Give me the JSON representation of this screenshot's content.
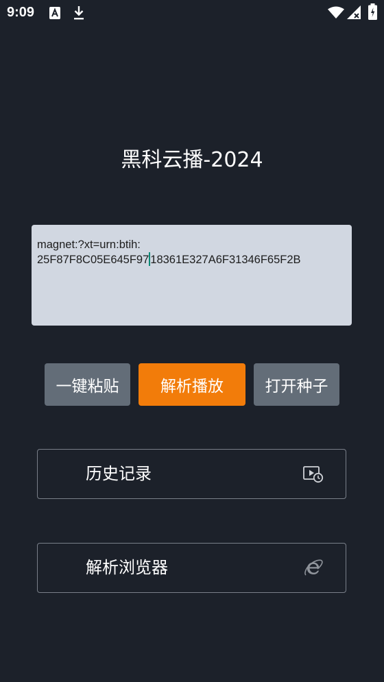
{
  "status_bar": {
    "time": "9:09"
  },
  "app": {
    "title": "黑科云播-2024"
  },
  "magnet_input": {
    "value_before_caret": "magnet:?xt=urn:btih:\n25F87F8C05E645F97",
    "value_after_caret": "18361E327A6F31346F65F2B"
  },
  "buttons": {
    "paste_label": "一键粘贴",
    "parse_play_label": "解析播放",
    "open_torrent_label": "打开种子"
  },
  "cards": {
    "history_label": "历史记录",
    "browser_label": "解析浏览器"
  },
  "colors": {
    "background": "#1c212a",
    "input_bg": "#d1d7e1",
    "accent_orange": "#f27c0a",
    "button_gray": "#636d78",
    "caret": "#0b8a76"
  },
  "icons": {
    "history": "video-history-icon",
    "browser": "internet-explorer-icon",
    "status": [
      "text-a-icon",
      "download-icon",
      "wifi-icon",
      "signal-icon",
      "battery-icon"
    ]
  }
}
